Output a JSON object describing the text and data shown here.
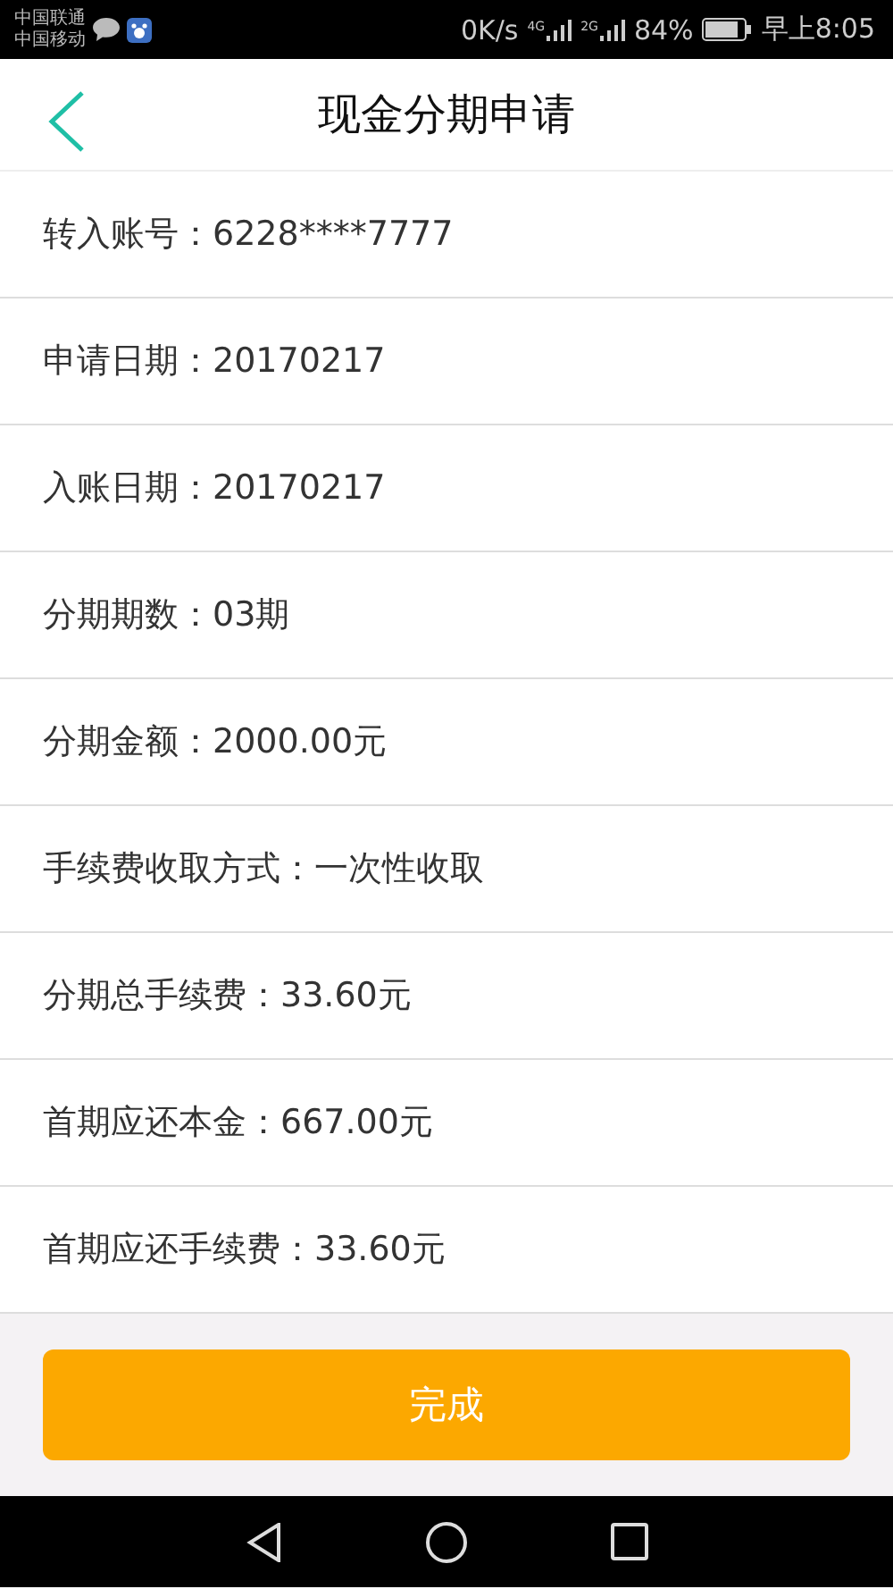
{
  "status_bar": {
    "carriers": [
      "中国联通",
      "中国移动"
    ],
    "speed": "0K/s",
    "network_1": "4G",
    "network_2": "2G",
    "battery": "84%",
    "time": "早上8:05"
  },
  "header": {
    "title": "现金分期申请"
  },
  "rows": [
    {
      "text": "转入账号：6228****7777"
    },
    {
      "text": "申请日期：20170217"
    },
    {
      "text": "入账日期：20170217"
    },
    {
      "text": "分期期数：03期"
    },
    {
      "text": "分期金额：2000.00元"
    },
    {
      "text": "手续费收取方式：一次性收取"
    },
    {
      "text": "分期总手续费：33.60元"
    },
    {
      "text": "首期应还本金：667.00元"
    },
    {
      "text": "首期应还手续费：33.60元"
    }
  ],
  "button": {
    "label": "完成"
  }
}
